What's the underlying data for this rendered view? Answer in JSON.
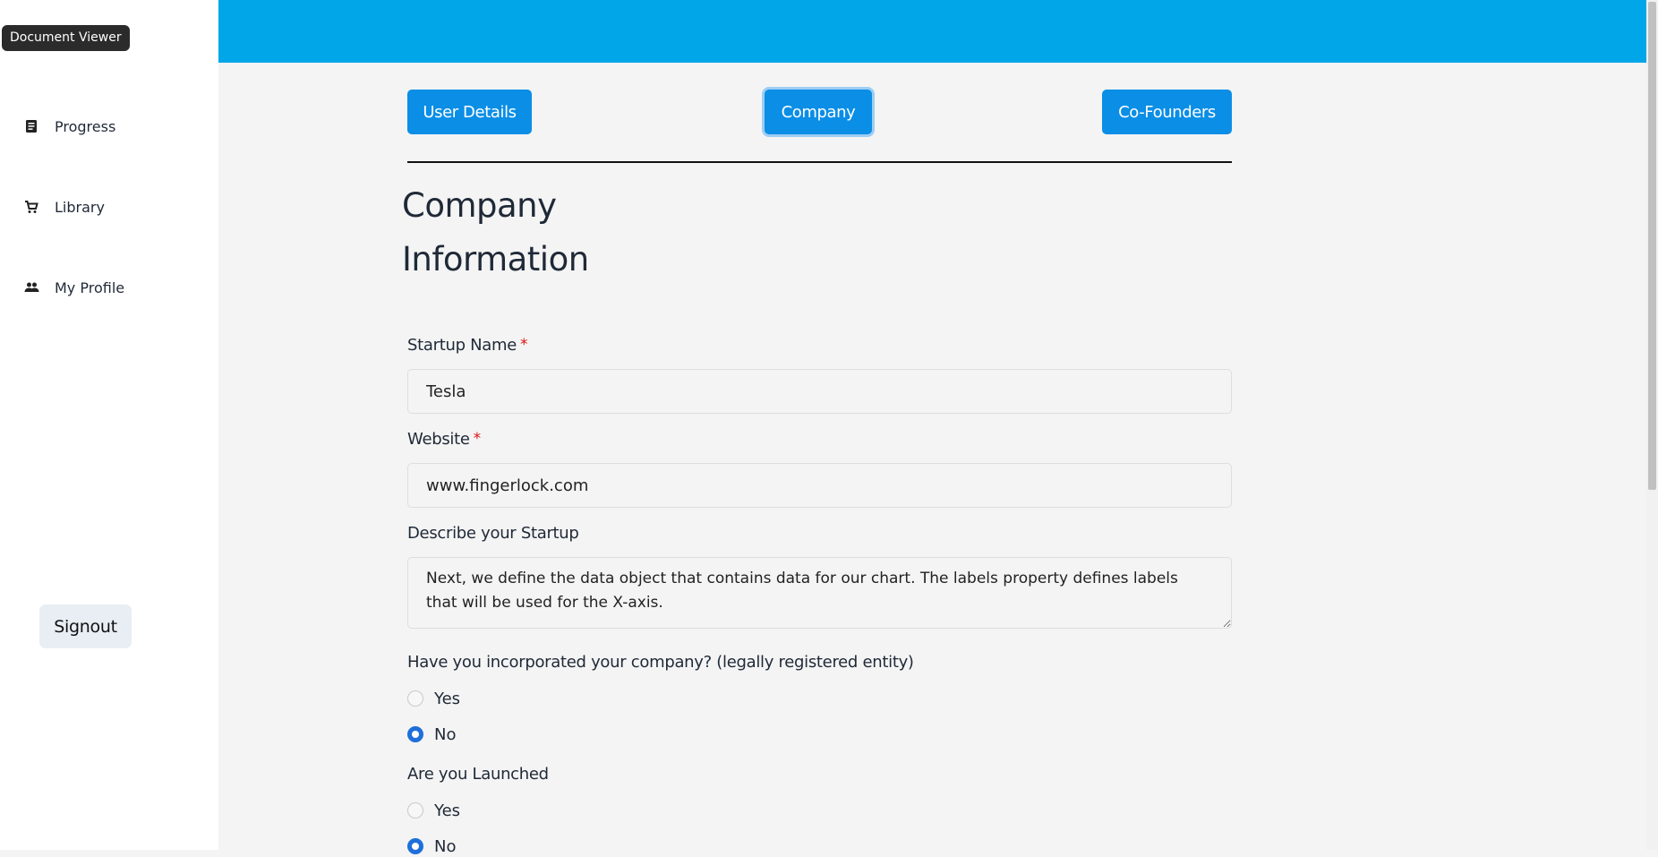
{
  "tooltip": "Document Viewer",
  "sidebar": {
    "items": [
      {
        "label": "Progress",
        "icon": "document-icon"
      },
      {
        "label": "Library",
        "icon": "cart-icon"
      },
      {
        "label": "My Profile",
        "icon": "people-icon"
      }
    ],
    "signout_label": "Signout"
  },
  "tabs": [
    {
      "label": "User Details",
      "active": false
    },
    {
      "label": "Company",
      "active": true
    },
    {
      "label": "Co-Founders",
      "active": false
    }
  ],
  "section_title_line1": "Company",
  "section_title_line2": "Information",
  "form": {
    "startup_name": {
      "label": "Startup Name",
      "required_mark": "*",
      "value": "Tesla"
    },
    "website": {
      "label": "Website",
      "required_mark": "*",
      "value": "www.fingerlock.com"
    },
    "describe": {
      "label": "Describe your Startup",
      "value": "Next, we define the data object that contains data for our chart. The labels property defines labels that will be used for the X-axis."
    },
    "incorporated": {
      "question": "Have you incorporated your company? (legally registered entity)",
      "options": [
        "Yes",
        "No"
      ],
      "selected": "No"
    },
    "launched": {
      "question": "Are you Launched",
      "options": [
        "Yes",
        "No"
      ],
      "selected": "No"
    }
  },
  "colors": {
    "topbar": "#00a6e7",
    "button": "#0a8ee6",
    "radio_checked": "#1e6fd9",
    "required": "#dd1111"
  }
}
